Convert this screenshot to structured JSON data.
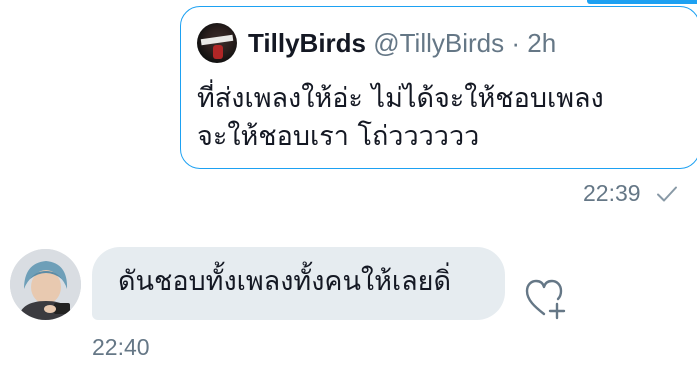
{
  "quoted_tweet": {
    "display_name": "TillyBirds",
    "handle": "@TillyBirds",
    "separator": "·",
    "age": "2h",
    "text_lines": [
      "ที่ส่งเพลงให้อ่ะ ไม่ได้จะให้ชอบเพลง",
      "จะให้ชอบเรา โถ่วววววว"
    ]
  },
  "sent_message": {
    "time": "22:39",
    "status_icon": "check-icon"
  },
  "received_message": {
    "text": "ดันชอบทั้งเพลงทั้งคนให้เลยดิ่",
    "time": "22:40",
    "action_icon": "heart-plus-icon"
  },
  "colors": {
    "accent": "#1da1f2",
    "bubble": "#e6ecf0",
    "meta": "#657786",
    "text": "#141823"
  }
}
